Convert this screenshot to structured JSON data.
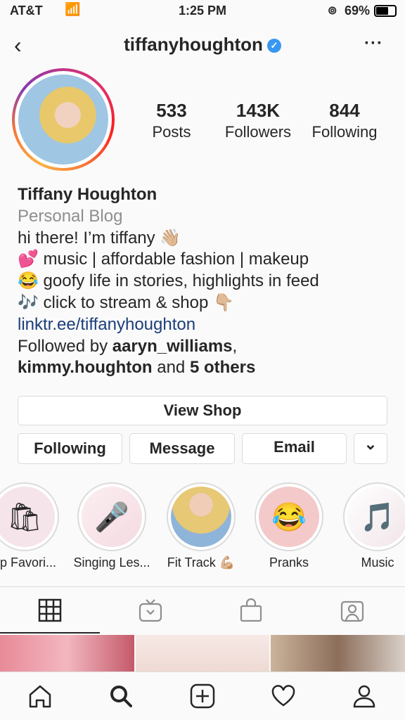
{
  "status_bar": {
    "carrier": "AT&T",
    "time": "1:25 PM",
    "battery": "69%"
  },
  "header": {
    "username": "tiffanyhoughton",
    "verified": true
  },
  "stats": [
    {
      "value": "533",
      "label": "Posts"
    },
    {
      "value": "143K",
      "label": "Followers"
    },
    {
      "value": "844",
      "label": "Following"
    }
  ],
  "bio": {
    "name": "Tiffany Houghton",
    "category": "Personal Blog",
    "lines": [
      "hi there! I’m tiffany 👋🏼",
      "💕 music | affordable fashion | makeup",
      "😂 goofy life in stories, highlights in feed",
      "🎶 click to stream & shop 👇🏼"
    ],
    "link": "linktr.ee/tiffanyhoughton",
    "followed_by_prefix": "Followed by ",
    "followed_user1": "aaryn_williams",
    "followed_sep": ",",
    "followed_user2": "kimmy.houghton",
    "followed_and": " and ",
    "followed_others": "5 others"
  },
  "buttons": {
    "view_shop": "View Shop",
    "following": "Following",
    "message": "Message",
    "email": "Email",
    "more": "⌄"
  },
  "highlights": [
    {
      "label": "op Favori..."
    },
    {
      "label": "Singing Les..."
    },
    {
      "label": "Fit Track 💪🏼"
    },
    {
      "label": "Pranks"
    },
    {
      "label": "Music"
    }
  ],
  "colors": {
    "link": "#1c3e7a",
    "verified": "#3897f0",
    "border": "#dbdbdb"
  }
}
